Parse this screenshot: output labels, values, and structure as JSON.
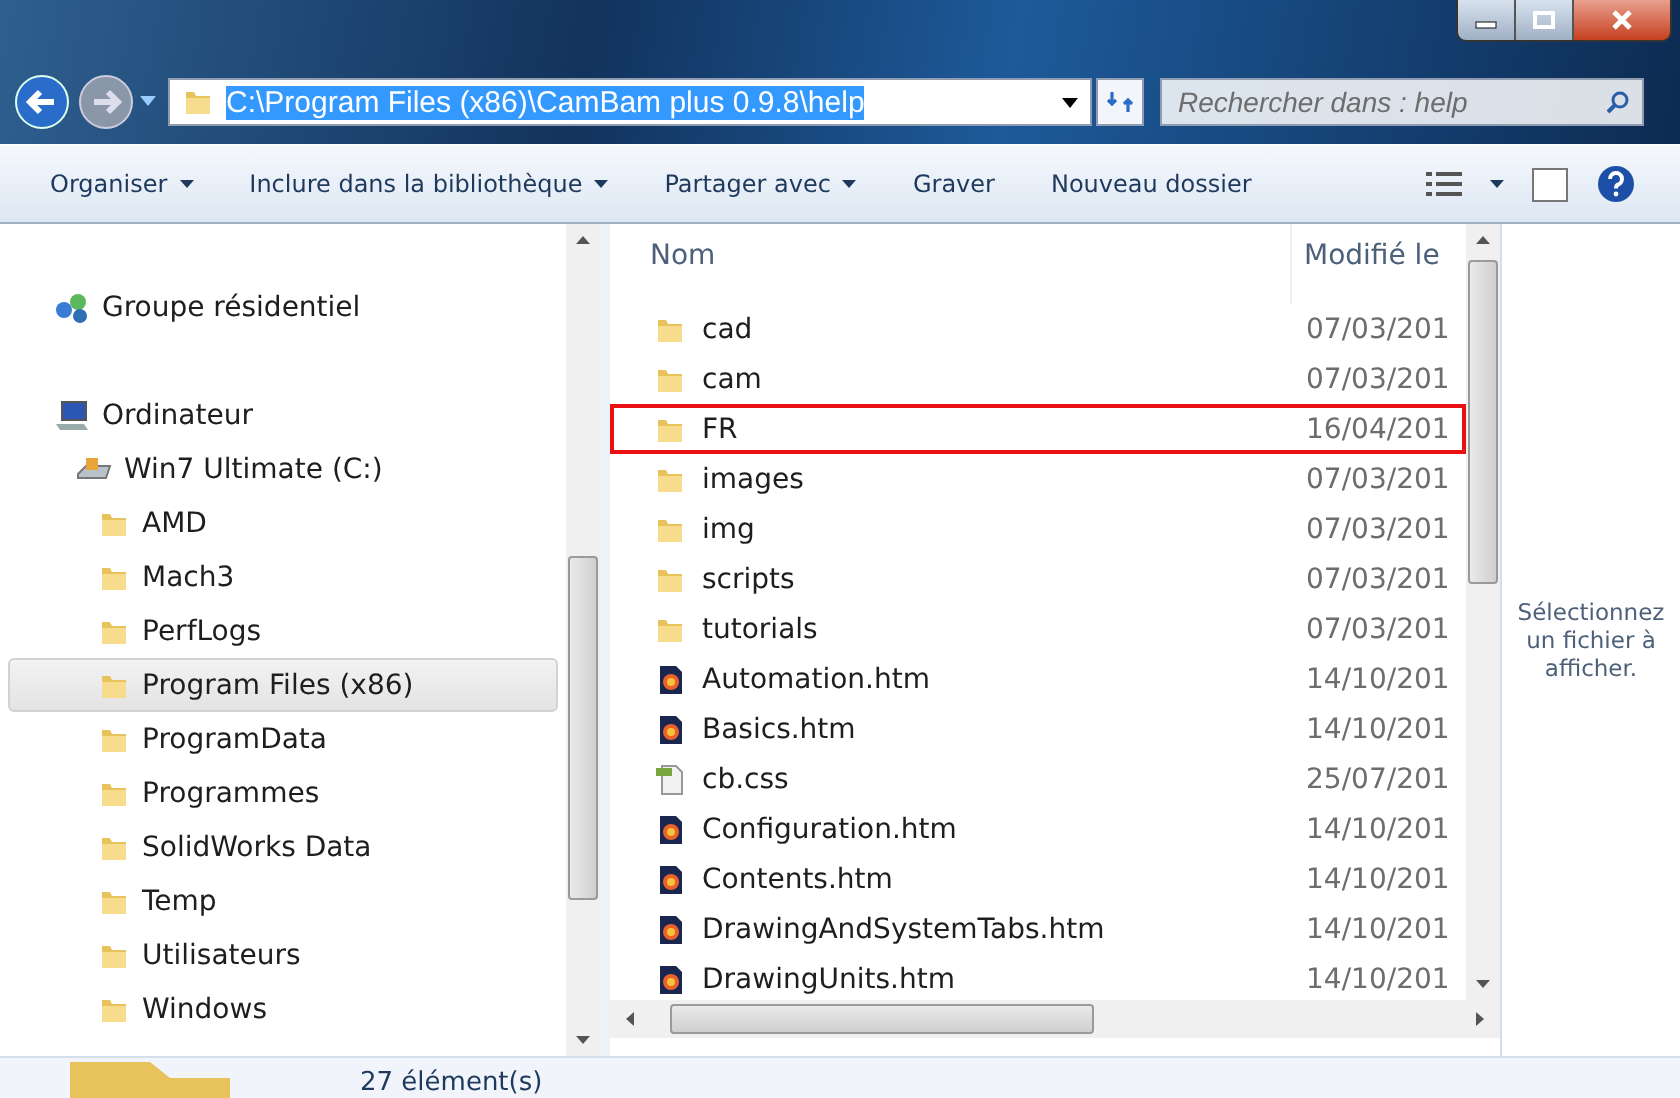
{
  "address_bar": {
    "path": "C:\\Program Files (x86)\\CamBam plus 0.9.8\\help",
    "selected": true
  },
  "search": {
    "placeholder": "Rechercher dans : help"
  },
  "toolbar": {
    "items": [
      {
        "label": "Organiser",
        "dropdown": true
      },
      {
        "label": "Inclure dans la bibliothèque",
        "dropdown": true
      },
      {
        "label": "Partager avec",
        "dropdown": true
      },
      {
        "label": "Graver",
        "dropdown": false
      },
      {
        "label": "Nouveau dossier",
        "dropdown": false
      }
    ]
  },
  "navigation": {
    "items": [
      {
        "label": "Groupe résidentiel",
        "kind": "homegroup",
        "selected": false
      },
      {
        "label": "Ordinateur",
        "kind": "computer",
        "selected": false,
        "children": [
          {
            "label": "Win7 Ultimate (C:)",
            "kind": "drive",
            "selected": false,
            "children": [
              {
                "label": "AMD",
                "kind": "folder",
                "selected": false
              },
              {
                "label": "Mach3",
                "kind": "folder",
                "selected": false
              },
              {
                "label": "PerfLogs",
                "kind": "folder",
                "selected": false
              },
              {
                "label": "Program Files (x86)",
                "kind": "folder",
                "selected": true
              },
              {
                "label": "ProgramData",
                "kind": "folder",
                "selected": false
              },
              {
                "label": "Programmes",
                "kind": "folder",
                "selected": false
              },
              {
                "label": "SolidWorks Data",
                "kind": "folder",
                "selected": false
              },
              {
                "label": "Temp",
                "kind": "folder",
                "selected": false
              },
              {
                "label": "Utilisateurs",
                "kind": "folder",
                "selected": false
              },
              {
                "label": "Windows",
                "kind": "folder",
                "selected": false
              }
            ]
          }
        ]
      }
    ]
  },
  "file_list": {
    "columns": [
      "Nom",
      "Modifié le"
    ],
    "rows": [
      {
        "name": "cad",
        "kind": "folder",
        "modified": "07/03/201",
        "highlighted": false
      },
      {
        "name": "cam",
        "kind": "folder",
        "modified": "07/03/201",
        "highlighted": false
      },
      {
        "name": "FR",
        "kind": "folder",
        "modified": "16/04/201",
        "highlighted": true
      },
      {
        "name": "images",
        "kind": "folder",
        "modified": "07/03/201",
        "highlighted": false
      },
      {
        "name": "img",
        "kind": "folder",
        "modified": "07/03/201",
        "highlighted": false
      },
      {
        "name": "scripts",
        "kind": "folder",
        "modified": "07/03/201",
        "highlighted": false
      },
      {
        "name": "tutorials",
        "kind": "folder",
        "modified": "07/03/201",
        "highlighted": false
      },
      {
        "name": "Automation.htm",
        "kind": "htm",
        "modified": "14/10/201",
        "highlighted": false
      },
      {
        "name": "Basics.htm",
        "kind": "htm",
        "modified": "14/10/201",
        "highlighted": false
      },
      {
        "name": "cb.css",
        "kind": "css",
        "modified": "25/07/201",
        "highlighted": false
      },
      {
        "name": "Configuration.htm",
        "kind": "htm",
        "modified": "14/10/201",
        "highlighted": false
      },
      {
        "name": "Contents.htm",
        "kind": "htm",
        "modified": "14/10/201",
        "highlighted": false
      },
      {
        "name": "DrawingAndSystemTabs.htm",
        "kind": "htm",
        "modified": "14/10/201",
        "highlighted": false
      },
      {
        "name": "DrawingUnits.htm",
        "kind": "htm",
        "modified": "14/10/201",
        "highlighted": false
      }
    ]
  },
  "preview": {
    "message": "Sélectionnez un fichier à afficher."
  },
  "status_bar": {
    "count": "27 élément(s)"
  }
}
